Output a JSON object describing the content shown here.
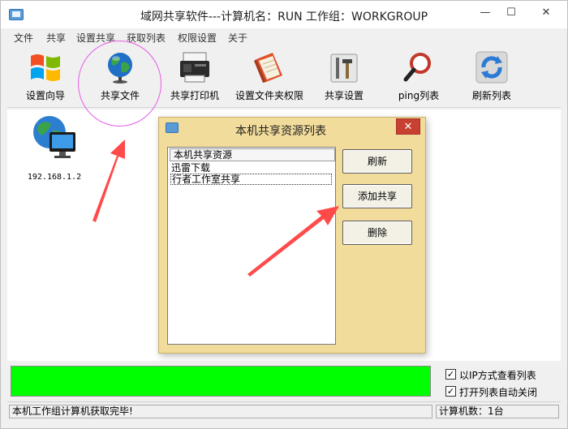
{
  "window": {
    "title": "域网共享软件---计算机名：RUN  工作组：WORKGROUP",
    "min_glyph": "—",
    "max_glyph": "☐",
    "close_glyph": "✕"
  },
  "menu": [
    "文件",
    "共享",
    "设置共享",
    "获取列表",
    "权限设置",
    "关于"
  ],
  "toolbar": [
    {
      "label": "设置向导",
      "icon": "windows-logo-icon"
    },
    {
      "label": "共享文件",
      "icon": "globe-icon"
    },
    {
      "label": "共享打印机",
      "icon": "printer-icon"
    },
    {
      "label": "设置文件夹权限",
      "icon": "folder-permission-icon"
    },
    {
      "label": "共享设置",
      "icon": "tools-icon"
    },
    {
      "label": "ping列表",
      "icon": "magnifier-icon"
    },
    {
      "label": "刷新列表",
      "icon": "refresh-icon"
    }
  ],
  "computers": [
    {
      "label": "192.168.1.2",
      "icon": "network-computer-icon"
    }
  ],
  "dialog": {
    "title": "本机共享资源列表",
    "close_glyph": "✕",
    "list_header": "本机共享资源",
    "items": [
      "迅雷下载",
      "行者工作室共享"
    ],
    "buttons": {
      "refresh": "刷新",
      "add": "添加共享",
      "delete": "删除"
    }
  },
  "options": {
    "view_by_ip": {
      "label": "以IP方式查看列表",
      "checked": true
    },
    "auto_close": {
      "label": "打开列表自动关闭",
      "checked": true
    }
  },
  "progress": {
    "value": 1.0,
    "color": "#00ff00"
  },
  "status": {
    "message": "本机工作组计算机获取完毕!",
    "count": "计算机数：1台"
  },
  "colors": {
    "dialog_bg": "#f2dc9b",
    "close_red": "#c84031",
    "annotation_red": "#ff4a4a",
    "highlight_ring": "#e65ce6"
  }
}
